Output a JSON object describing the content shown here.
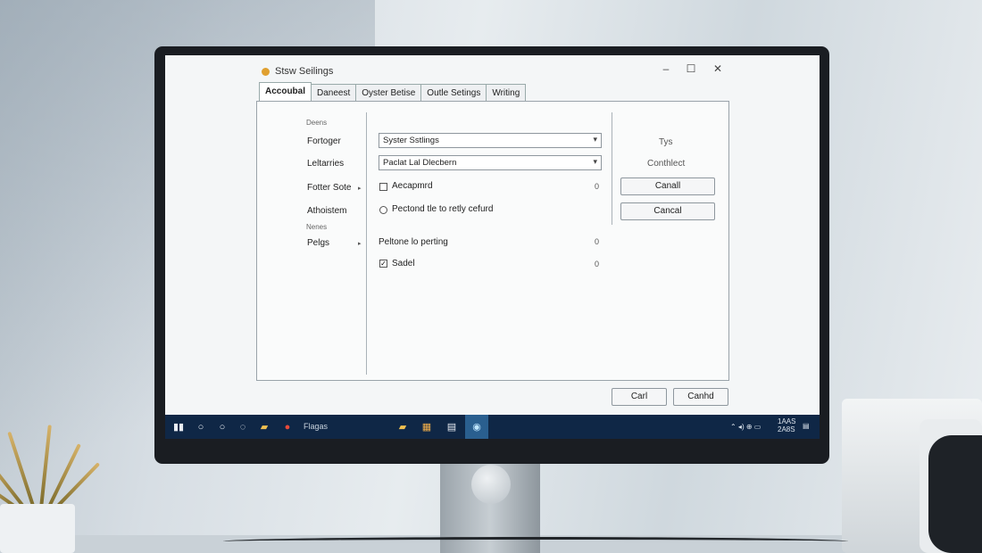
{
  "window": {
    "title": "Stsw Seilings",
    "controls": {
      "minimize": "–",
      "maximize": "☐",
      "close": "✕"
    }
  },
  "tabs": [
    {
      "label": "Accoubal",
      "active": true
    },
    {
      "label": "Daneest",
      "active": false
    },
    {
      "label": "Oyster Betise",
      "active": false
    },
    {
      "label": "Outle Setings",
      "active": false
    },
    {
      "label": "Writing",
      "active": false
    }
  ],
  "left_column": {
    "heading": "Deens",
    "items": [
      {
        "label": "Fortoger"
      },
      {
        "label": "Leltarries"
      },
      {
        "label": "Fotter Sote"
      },
      {
        "label": "Athoistem"
      },
      {
        "label": "Pelgs"
      }
    ],
    "subheading": "Nenes"
  },
  "middle_column": {
    "select1": {
      "value": "Syster Sstlings"
    },
    "select2": {
      "value": "Paclat Lal Dlecbern"
    },
    "options": [
      {
        "label": "Aecapmrd",
        "control": "checkbox",
        "checked": false,
        "value": "0"
      },
      {
        "label": "Pectond tle to retly cefurd",
        "control": "radio",
        "checked": false,
        "value": ""
      },
      {
        "label": "Peltone lo perting",
        "control": "none",
        "checked": false,
        "value": "0"
      },
      {
        "label": "Sadel",
        "control": "checkbox",
        "checked": true,
        "value": "0"
      }
    ]
  },
  "right_column": {
    "label1": "Tys",
    "label2": "Conthlect",
    "button1": "Canall",
    "button2": "Cancal"
  },
  "footer": {
    "button1": "Carl",
    "button2": "Canhd"
  },
  "taskbar": {
    "app_text": "Flagas",
    "tray_text": "1AAS\n2A8S"
  }
}
